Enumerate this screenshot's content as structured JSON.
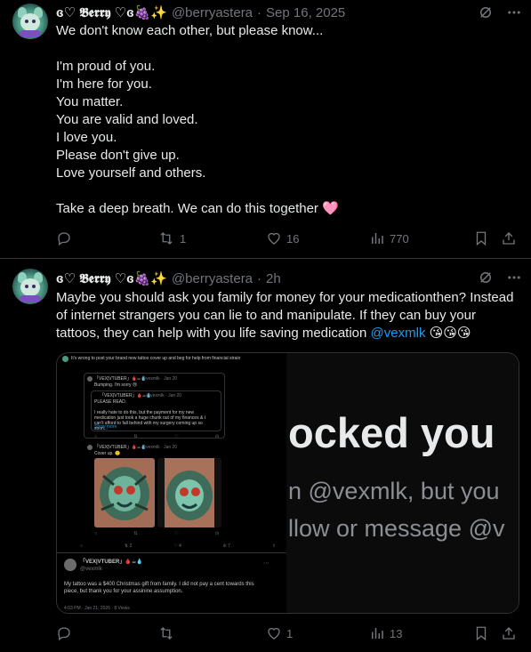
{
  "posts": [
    {
      "display_name": "ɞ♡ 𝕭𝖊𝖗𝖗𝖞 ♡ɞ🍇✨",
      "handle": "@berryastera",
      "time": "Sep 16, 2025",
      "text": "We don't know each other, but please know...\n\nI'm proud of you.\nI'm here for you.\nYou matter.\nYou are valid and loved.\nI love you.\nPlease don't give up.\nLove yourself and others.\n\nTake a deep breath. We can do this together 🩷",
      "replies": "",
      "reposts": "1",
      "likes": "16",
      "views": "770"
    },
    {
      "display_name": "ɞ♡ 𝕭𝖊𝖗𝖗𝖞 ♡ɞ🍇✨",
      "handle": "@berryastera",
      "time": "2h",
      "text_before": "Maybe you should ask you family for money for your medicationthen? Instead of internet strangers you can lie to and manipulate. If they can buy your tattoos, they can help with you life saving medication ",
      "mention": "@vexmlk",
      "text_after": " 😘😘😘",
      "replies": "",
      "reposts": "",
      "likes": "1",
      "views": "13",
      "media": {
        "left": {
          "quote_line": "It's wrong to post your brand new tattoo cover up and beg for help from financial strain",
          "inner1_name": "「VEX|VTUBER」🩸☕💧",
          "inner1_meta": "@vexmlk · Jan 20",
          "inner1_text": "Bumping. I'm sorry 😢",
          "inner2_name": "「VEX|VTUBER」🩸☕💧",
          "inner2_meta": "@vexmlk · Jan 20",
          "inner2_text": "PLEASE READ.\n\nI really hate to do this, but the payment for my new medication just took a huge chunk out of my finances & I can't afford to fall behind with my surgery coming up so soon...",
          "inner2_more": "Show more",
          "inner3_name": "「VEX|VTUBER」🩸☕💧",
          "inner3_meta": "@vexmlk · Jan 20",
          "inner3_text": "Cover up. 🙂",
          "stats_a": [
            "2",
            "4",
            "7"
          ],
          "reply_name": "「VEX|VTUBER」🩸☕💧",
          "reply_handle": "@vexmlk",
          "reply_text": "My tattoo was a $400 Christmas gift from family. I did not pay a cent towards this piece, but thank you for your assinine assumption.",
          "reply_footer": "4:03 PM · Jan 21, 2026 · 8 Views"
        },
        "right": {
          "line1": "ocked you",
          "line2": "n @vexmlk, but you",
          "line3": "llow or message @v"
        }
      }
    }
  ]
}
